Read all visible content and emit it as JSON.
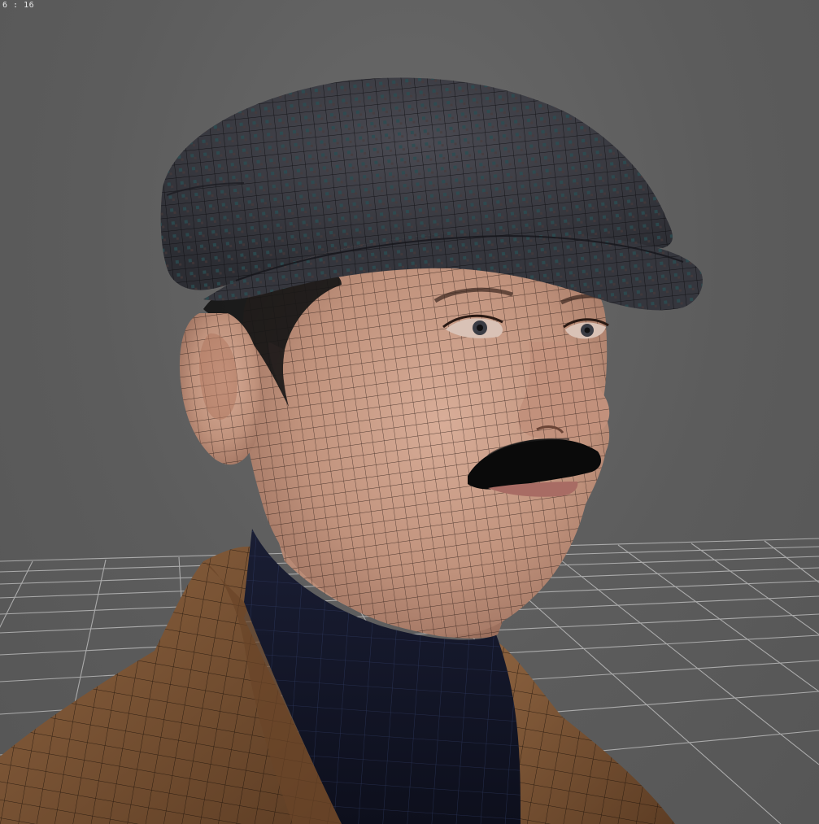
{
  "viewport": {
    "frame_counter": "6 : 16",
    "background_color": "#5e5e5e",
    "grid_color": "#b8b8b8"
  },
  "model": {
    "hat_color": "#3b3d44",
    "hat_pattern_color": "#2a4a4e",
    "skin_color": "#c69a86",
    "jacket_color": "#7a5434",
    "shirt_color": "#15182a",
    "wireframe_color": "#1a1410",
    "hair_color": "#111111"
  }
}
